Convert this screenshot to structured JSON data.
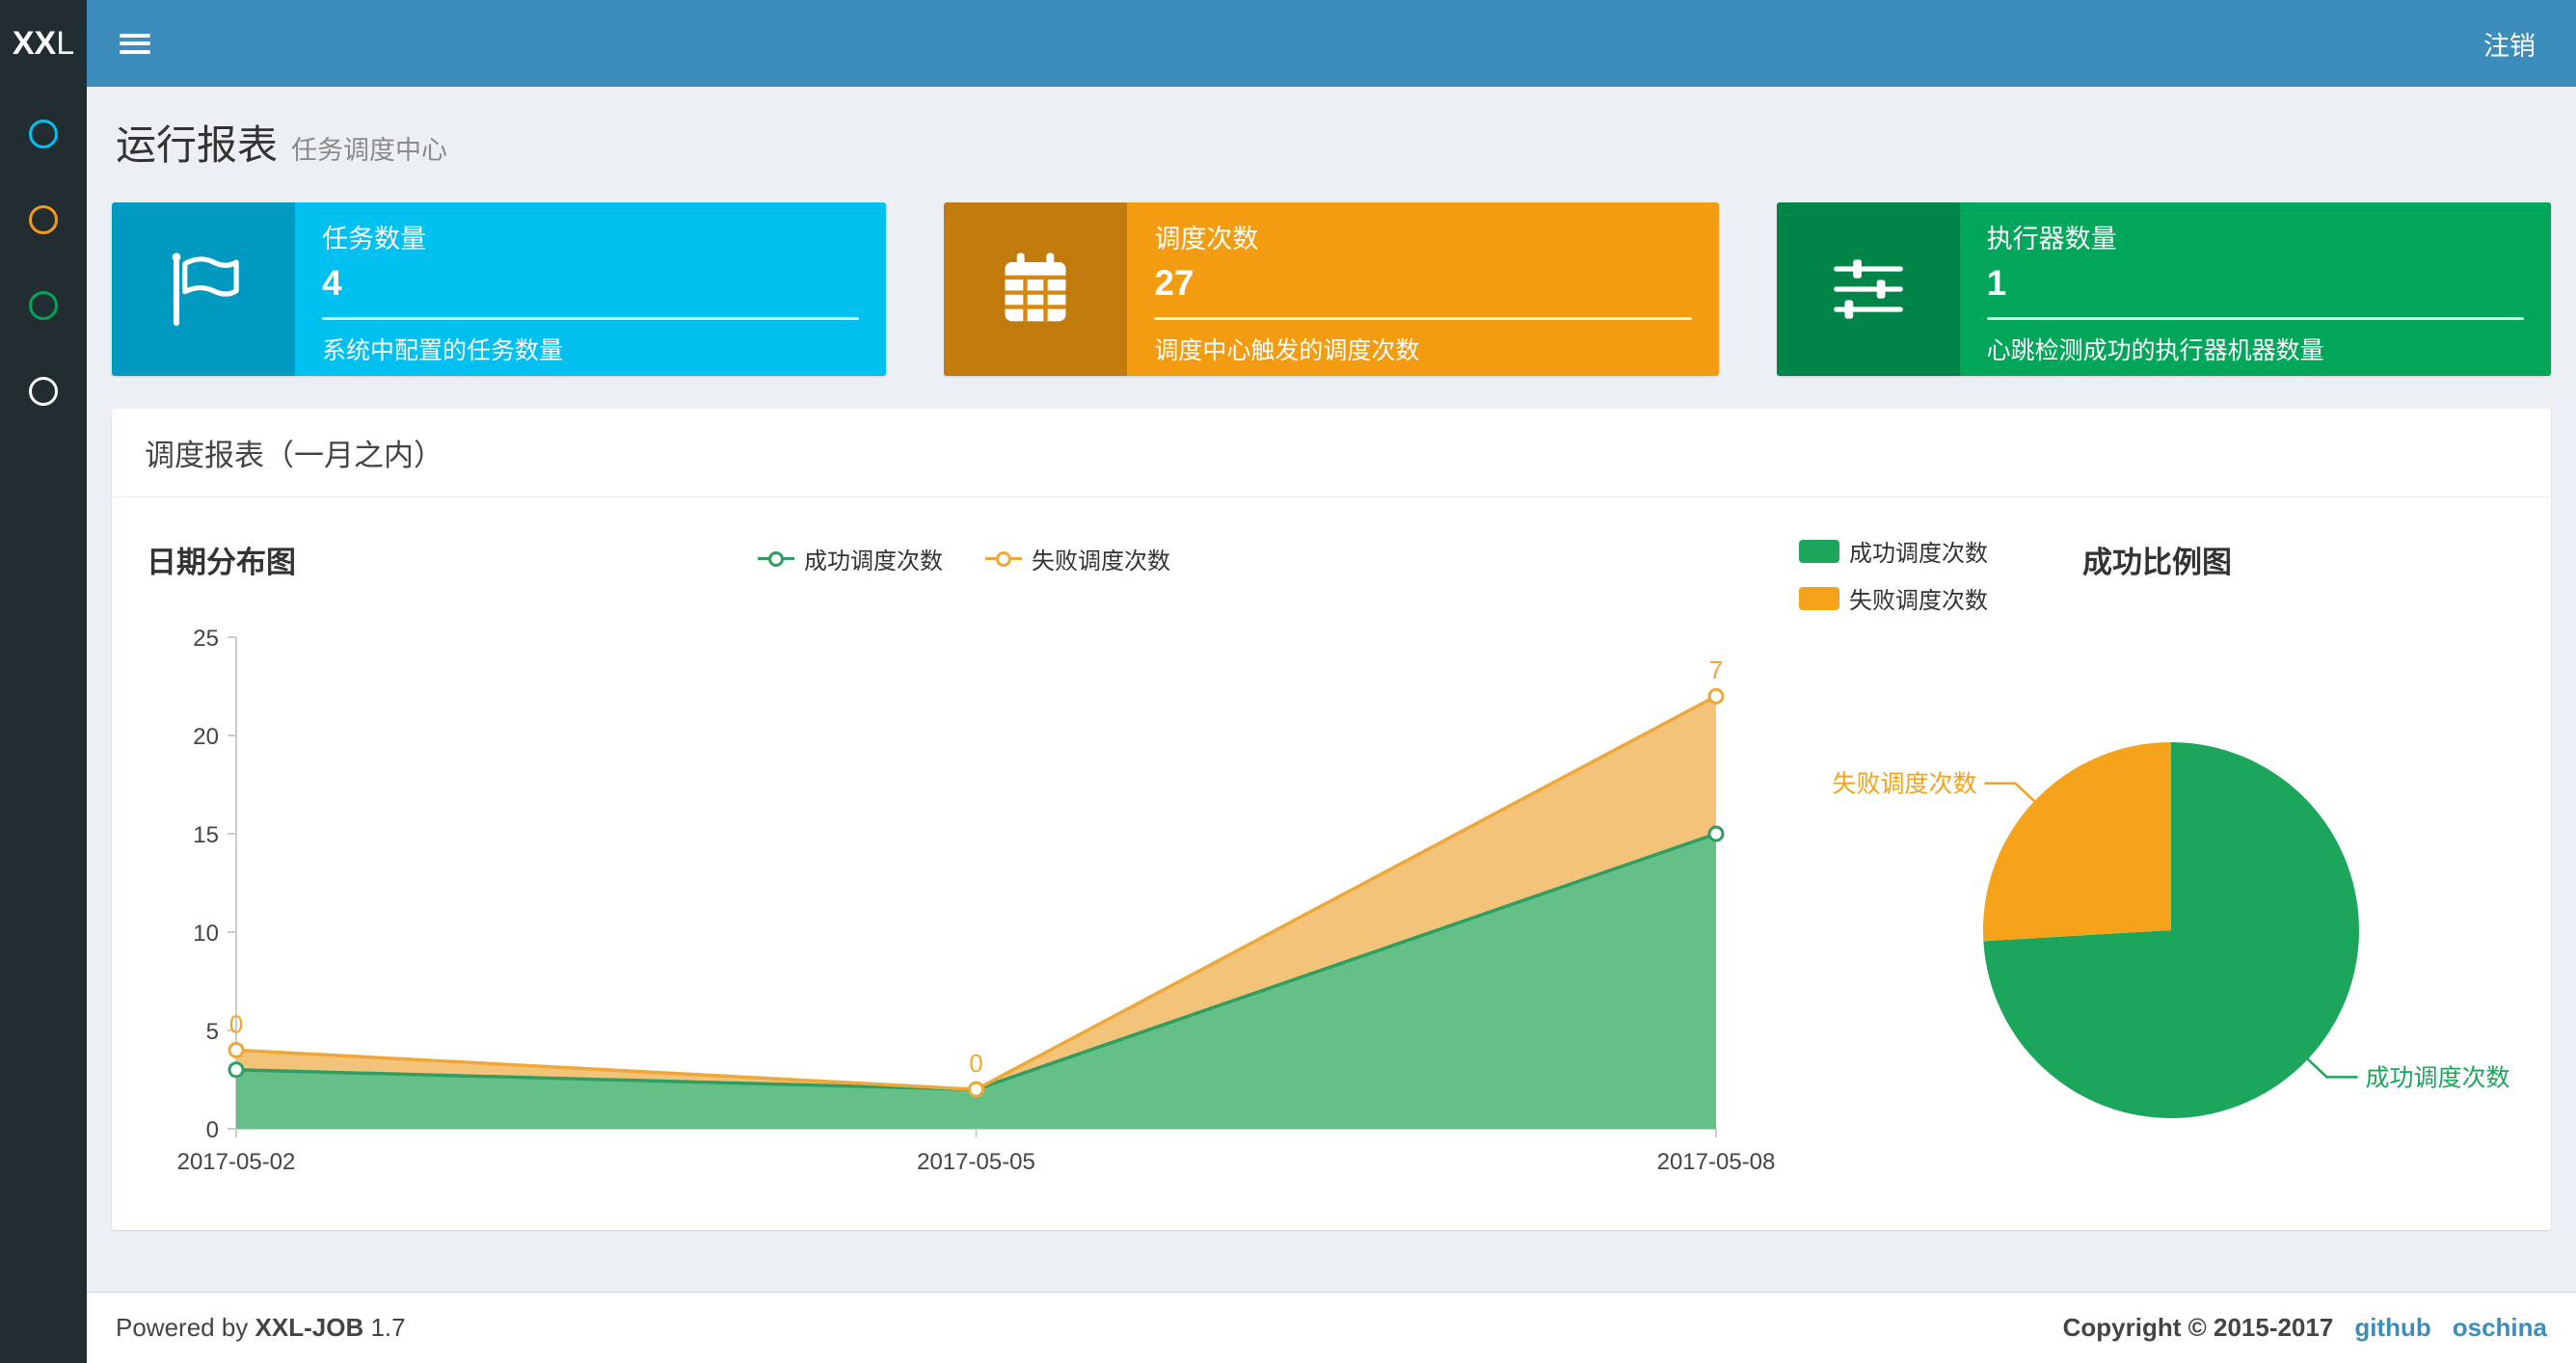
{
  "colors": {
    "header_bg": "#3c8dbc",
    "sidebar_bg": "#222d32",
    "content_bg": "#ecf0f5",
    "link": "#3c8dbc",
    "aqua": "#00c0ef",
    "orange": "#f39c12",
    "green": "#00a65a"
  },
  "header": {
    "logo_bold": "XX",
    "logo_light": "L",
    "logout_label": "注销"
  },
  "sidebar": {
    "items": [
      {
        "icon": "circle-icon",
        "color": "#00c0ef"
      },
      {
        "icon": "circle-icon",
        "color": "#f39c12"
      },
      {
        "icon": "circle-icon",
        "color": "#00a65a"
      },
      {
        "icon": "circle-icon",
        "color": "#ffffff"
      }
    ]
  },
  "page": {
    "title": "运行报表",
    "subtitle": "任务调度中心"
  },
  "info_boxes": [
    {
      "icon": "flag-icon",
      "label": "任务数量",
      "value": "4",
      "description": "系统中配置的任务数量",
      "color": "#00c0ef"
    },
    {
      "icon": "calendar-icon",
      "label": "调度次数",
      "value": "27",
      "description": "调度中心触发的调度次数",
      "color": "#f39c12"
    },
    {
      "icon": "sliders-icon",
      "label": "执行器数量",
      "value": "1",
      "description": "心跳检测成功的执行器机器数量",
      "color": "#00a65a"
    }
  ],
  "panel": {
    "title": "调度报表（一月之内）"
  },
  "chart_data": [
    {
      "type": "area",
      "title": "日期分布图",
      "x": [
        "2017-05-02",
        "2017-05-05",
        "2017-05-08"
      ],
      "stacked": true,
      "series": [
        {
          "name": "成功调度次数",
          "values": [
            3,
            2,
            15
          ],
          "color": "#2f9e63",
          "fill": "#65c087"
        },
        {
          "name": "失败调度次数",
          "values": [
            1,
            0,
            7
          ],
          "color": "#efa838",
          "fill": "#f3c37a",
          "point_labels": [
            "0",
            "0",
            "7"
          ]
        }
      ],
      "ylim": [
        0,
        25
      ],
      "yticks": [
        0,
        5,
        10,
        15,
        20,
        25
      ],
      "legend_position": "top-center",
      "grid": false
    },
    {
      "type": "pie",
      "title": "成功比例图",
      "legend_position": "top-left",
      "slices": [
        {
          "name": "成功调度次数",
          "value": 20,
          "color": "#1ca65b"
        },
        {
          "name": "失败调度次数",
          "value": 7,
          "color": "#f5a31a"
        }
      ]
    }
  ],
  "footer": {
    "powered_prefix": "Powered by",
    "product": "XXL-JOB",
    "version": "1.7",
    "copyright": "Copyright © 2015-2017",
    "links": [
      "github",
      "oschina"
    ]
  }
}
